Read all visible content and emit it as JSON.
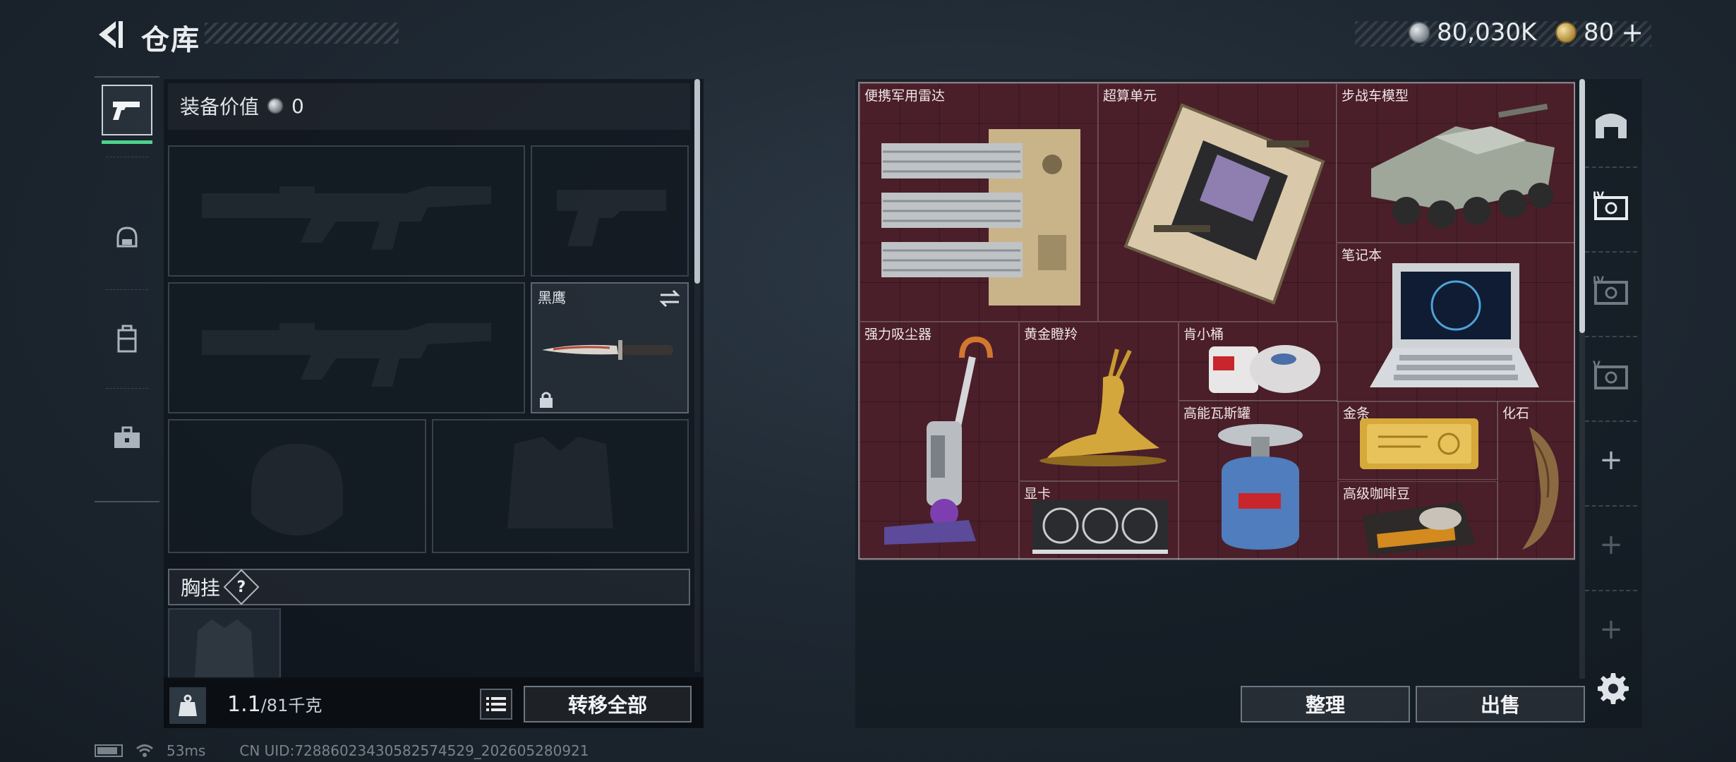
{
  "header": {
    "title": "仓库",
    "silver_amount": "80,030K",
    "gold_amount": "80",
    "gold_plus": "+"
  },
  "left_rail": {
    "items": [
      {
        "name": "weapons",
        "icon": "pistol-icon",
        "active": true
      },
      {
        "name": "helmet",
        "icon": "helmet-icon",
        "active": false
      },
      {
        "name": "backpack",
        "icon": "backpack-icon",
        "active": false
      },
      {
        "name": "toolbox",
        "icon": "toolbox-icon",
        "active": false
      }
    ]
  },
  "equipment": {
    "value_label": "装备价值",
    "value": "0",
    "melee_label": "黑鹰",
    "chest_rig_label": "胸挂",
    "chest_rig_help": "?",
    "weight_current": "1.1",
    "weight_max": "/81",
    "weight_unit": "千克",
    "transfer_all": "转移全部"
  },
  "storage": {
    "items": [
      {
        "label": "便携军用雷达",
        "icon": "radar-icon"
      },
      {
        "label": "超算单元",
        "icon": "motherboard-icon"
      },
      {
        "label": "步战车模型",
        "icon": "ifv-model-icon"
      },
      {
        "label": "笔记本",
        "icon": "laptop-icon"
      },
      {
        "label": "强力吸尘器",
        "icon": "vacuum-icon"
      },
      {
        "label": "黄金瞪羚",
        "icon": "gold-gazelle-icon"
      },
      {
        "label": "肯小桶",
        "icon": "bucket-icon"
      },
      {
        "label": "高能瓦斯罐",
        "icon": "gas-canister-icon"
      },
      {
        "label": "金条",
        "icon": "gold-bar-icon"
      },
      {
        "label": "化石",
        "icon": "fossil-icon"
      },
      {
        "label": "显卡",
        "icon": "graphics-card-icon"
      },
      {
        "label": "高级咖啡豆",
        "icon": "coffee-beans-icon"
      }
    ],
    "sort_button": "整理",
    "sell_button": "出售"
  },
  "status_bar": {
    "ping": "53ms",
    "uid": "CN UID:72886023430582574529_202605280921"
  }
}
